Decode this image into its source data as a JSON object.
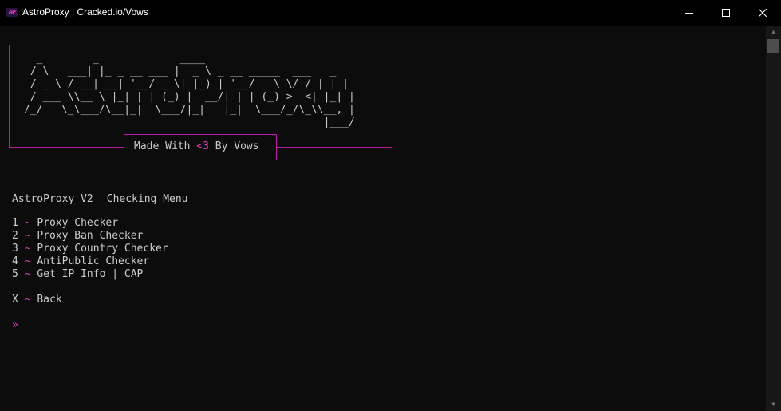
{
  "window": {
    "icon_text": "AP",
    "title": "AstroProxy | Cracked.io/Vows"
  },
  "banner": {
    "ascii_art": "  _        _             ____\n / \\   ___| |_ _ __ ___ |  _ \\ _ __ _____  ___   _\n / _ \\ / __| __| '__/ _ \\| |_) | '__/ _ \\ \\/ / | | |\n / ___ \\\\__ \\ |_| | | (_) |  __/| | | (_) >  <| |_| |\n/_/   \\_\\___/\\__|_|  \\___/|_|   |_|  \\___/_/\\_\\\\__, |\n                                                |___/",
    "made_with_prefix": "Made With ",
    "made_with_heart": "<3",
    "made_with_suffix": " By Vows"
  },
  "menu": {
    "app_name": "AstroProxy V2",
    "menu_title": "Checking Menu",
    "separator": "~",
    "items": [
      {
        "key": "1",
        "label": "Proxy Checker"
      },
      {
        "key": "2",
        "label": "Proxy Ban Checker"
      },
      {
        "key": "3",
        "label": "Proxy Country Checker"
      },
      {
        "key": "4",
        "label": "AntiPublic Checker"
      },
      {
        "key": "5",
        "label": "Get IP Info | CAP"
      }
    ],
    "back": {
      "key": "X",
      "label": "Back"
    },
    "prompt": "»"
  },
  "colors": {
    "accent": "#e23ec1",
    "border": "#b81e9f",
    "text": "#cccccc",
    "background": "#0c0c0c"
  }
}
